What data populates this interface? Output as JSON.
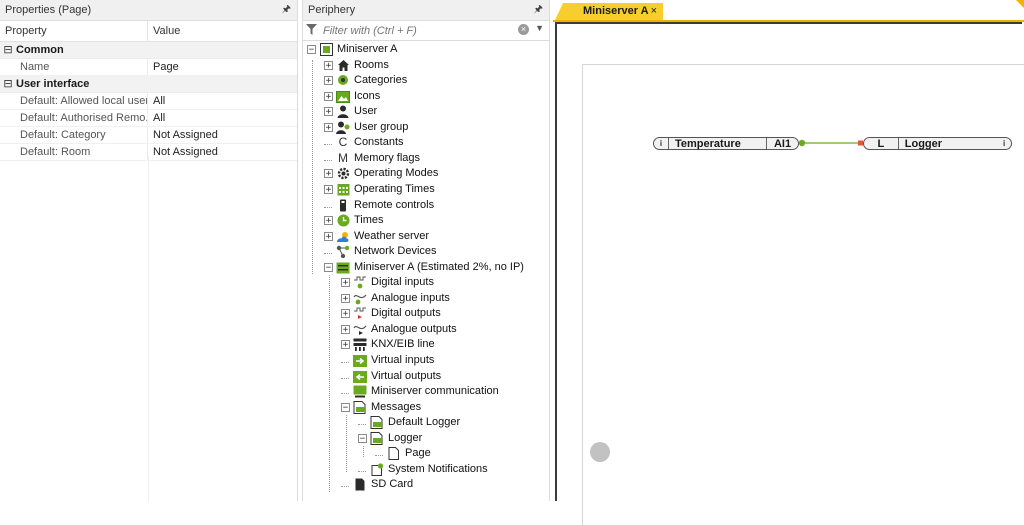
{
  "properties": {
    "title": "Properties (Page)",
    "pin": "🖈",
    "col_property": "Property",
    "col_value": "Value",
    "categories": [
      {
        "name": "Common",
        "toggle": "⊟",
        "rows": [
          {
            "property": "Name",
            "value": "Page"
          }
        ]
      },
      {
        "name": "User interface",
        "toggle": "⊟",
        "rows": [
          {
            "property": "Default: Allowed local users",
            "value": "All"
          },
          {
            "property": "Default: Authorised Remo...",
            "value": "All"
          },
          {
            "property": "Default: Category",
            "value": "Not Assigned"
          },
          {
            "property": "Default: Room",
            "value": "Not Assigned"
          }
        ]
      }
    ]
  },
  "periphery": {
    "title": "Periphery",
    "pin": "🖈",
    "filter_placeholder": "Filter with (Ctrl + F)",
    "tree": [
      {
        "label": "Miniserver A",
        "icon": "miniserver-icon"
      },
      {
        "label": "Rooms",
        "icon": "house-icon"
      },
      {
        "label": "Categories",
        "icon": "categories-icon"
      },
      {
        "label": "Icons",
        "icon": "image-icon"
      },
      {
        "label": "User",
        "icon": "user-icon"
      },
      {
        "label": "User group",
        "icon": "user-group-icon"
      },
      {
        "label": "Constants",
        "icon": "constant-c-icon"
      },
      {
        "label": "Memory flags",
        "icon": "memory-m-icon"
      },
      {
        "label": "Operating Modes",
        "icon": "gear-icon"
      },
      {
        "label": "Operating Times",
        "icon": "calendar-icon"
      },
      {
        "label": "Remote controls",
        "icon": "remote-icon"
      },
      {
        "label": "Times",
        "icon": "clock-icon"
      },
      {
        "label": "Weather server",
        "icon": "weather-icon"
      },
      {
        "label": "Network Devices",
        "icon": "network-icon"
      },
      {
        "label": "Miniserver A (Estimated 2%, no IP)",
        "icon": "miniserver-device-icon"
      },
      {
        "label": "Digital inputs",
        "icon": "digital-input-icon"
      },
      {
        "label": "Analogue inputs",
        "icon": "analog-input-icon"
      },
      {
        "label": "Digital outputs",
        "icon": "digital-output-icon"
      },
      {
        "label": "Analogue outputs",
        "icon": "analog-output-icon"
      },
      {
        "label": "KNX/EIB line",
        "icon": "knx-icon"
      },
      {
        "label": "Virtual inputs",
        "icon": "virtual-input-icon"
      },
      {
        "label": "Virtual outputs",
        "icon": "virtual-output-icon"
      },
      {
        "label": "Miniserver communication",
        "icon": "communication-icon"
      },
      {
        "label": "Messages",
        "icon": "messages-icon"
      },
      {
        "label": "Default Logger",
        "icon": "logger-icon"
      },
      {
        "label": "Logger",
        "icon": "logger-icon"
      },
      {
        "label": "Page",
        "icon": "page-icon"
      },
      {
        "label": "System Notifications",
        "icon": "notification-icon"
      },
      {
        "label": "SD Card",
        "icon": "sd-card-icon"
      }
    ]
  },
  "editor": {
    "tab_label": "Miniserver A",
    "tab_close": "×",
    "blocks": {
      "input_info": "i",
      "input_name": "Temperature",
      "input_port": "AI1",
      "logger_port": "L",
      "logger_name": "Logger",
      "logger_info": "i"
    }
  },
  "colors": {
    "accent": "#f8ce2e",
    "green": "#6aaa1f",
    "connector": "#6aaa1f",
    "input_pin": "#e5553a"
  }
}
